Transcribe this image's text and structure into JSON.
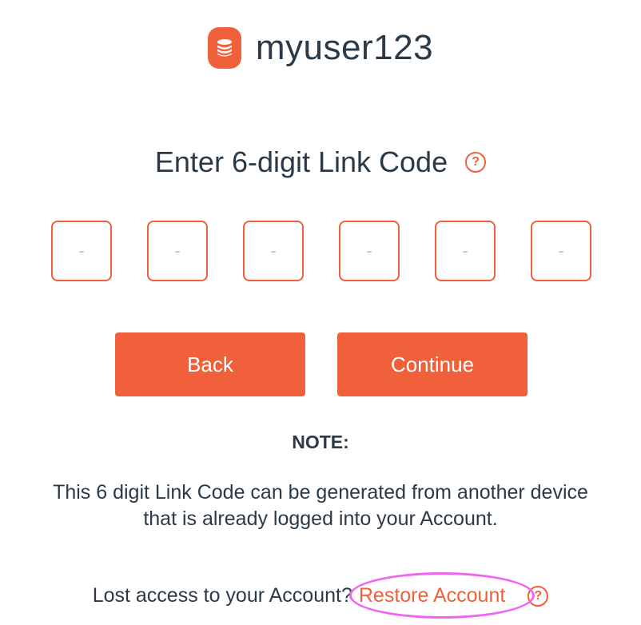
{
  "header": {
    "brand_icon": "database-icon",
    "username": "myuser123"
  },
  "title": {
    "text": "Enter 6-digit Link Code",
    "help_icon": "help-circle-icon",
    "help_glyph": "?"
  },
  "code_inputs": [
    {
      "value": "",
      "placeholder": "-"
    },
    {
      "value": "",
      "placeholder": "-"
    },
    {
      "value": "",
      "placeholder": "-"
    },
    {
      "value": "",
      "placeholder": "-"
    },
    {
      "value": "",
      "placeholder": "-"
    },
    {
      "value": "",
      "placeholder": "-"
    }
  ],
  "buttons": {
    "back_label": "Back",
    "continue_label": "Continue"
  },
  "note": {
    "heading": "NOTE:",
    "line1": "This 6 digit Link Code can be generated from another device",
    "line2": "that is already logged into your Account."
  },
  "footer": {
    "prompt": "Lost access to your Account?",
    "restore_label": "Restore Account",
    "help_icon": "help-circle-icon",
    "help_glyph": "?"
  },
  "colors": {
    "accent": "#f0603a",
    "text": "#2b3a48",
    "highlight": "#f065f0",
    "placeholder": "#b8bfc7"
  }
}
